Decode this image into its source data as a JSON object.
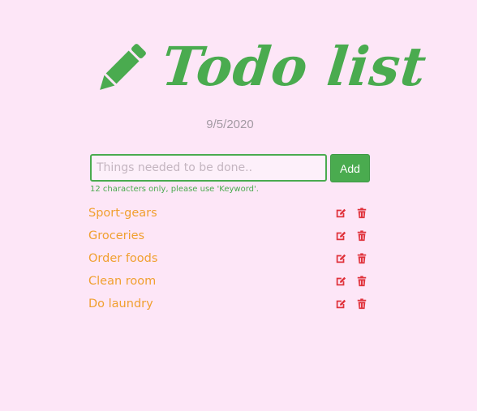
{
  "header": {
    "title": "Todo list",
    "icon": "pencil-icon",
    "accent_color": "#4aab4f"
  },
  "date": "9/5/2020",
  "form": {
    "input_placeholder": "Things needed to be done..",
    "input_value": "",
    "add_label": "Add",
    "hint": "12 characters only, please use 'Keyword'."
  },
  "todos": [
    {
      "text": "Sport-gears",
      "edit_icon": "edit-icon",
      "delete_icon": "trash-icon"
    },
    {
      "text": "Groceries",
      "edit_icon": "edit-icon",
      "delete_icon": "trash-icon"
    },
    {
      "text": "Order foods",
      "edit_icon": "edit-icon",
      "delete_icon": "trash-icon"
    },
    {
      "text": "Clean room",
      "edit_icon": "edit-icon",
      "delete_icon": "trash-icon"
    },
    {
      "text": "Do laundry",
      "edit_icon": "edit-icon",
      "delete_icon": "trash-icon"
    }
  ],
  "colors": {
    "background": "#fde6f7",
    "accent": "#4aab4f",
    "task_text": "#f0a030",
    "action_icons": "#e0333c",
    "date": "#a39aa3"
  }
}
